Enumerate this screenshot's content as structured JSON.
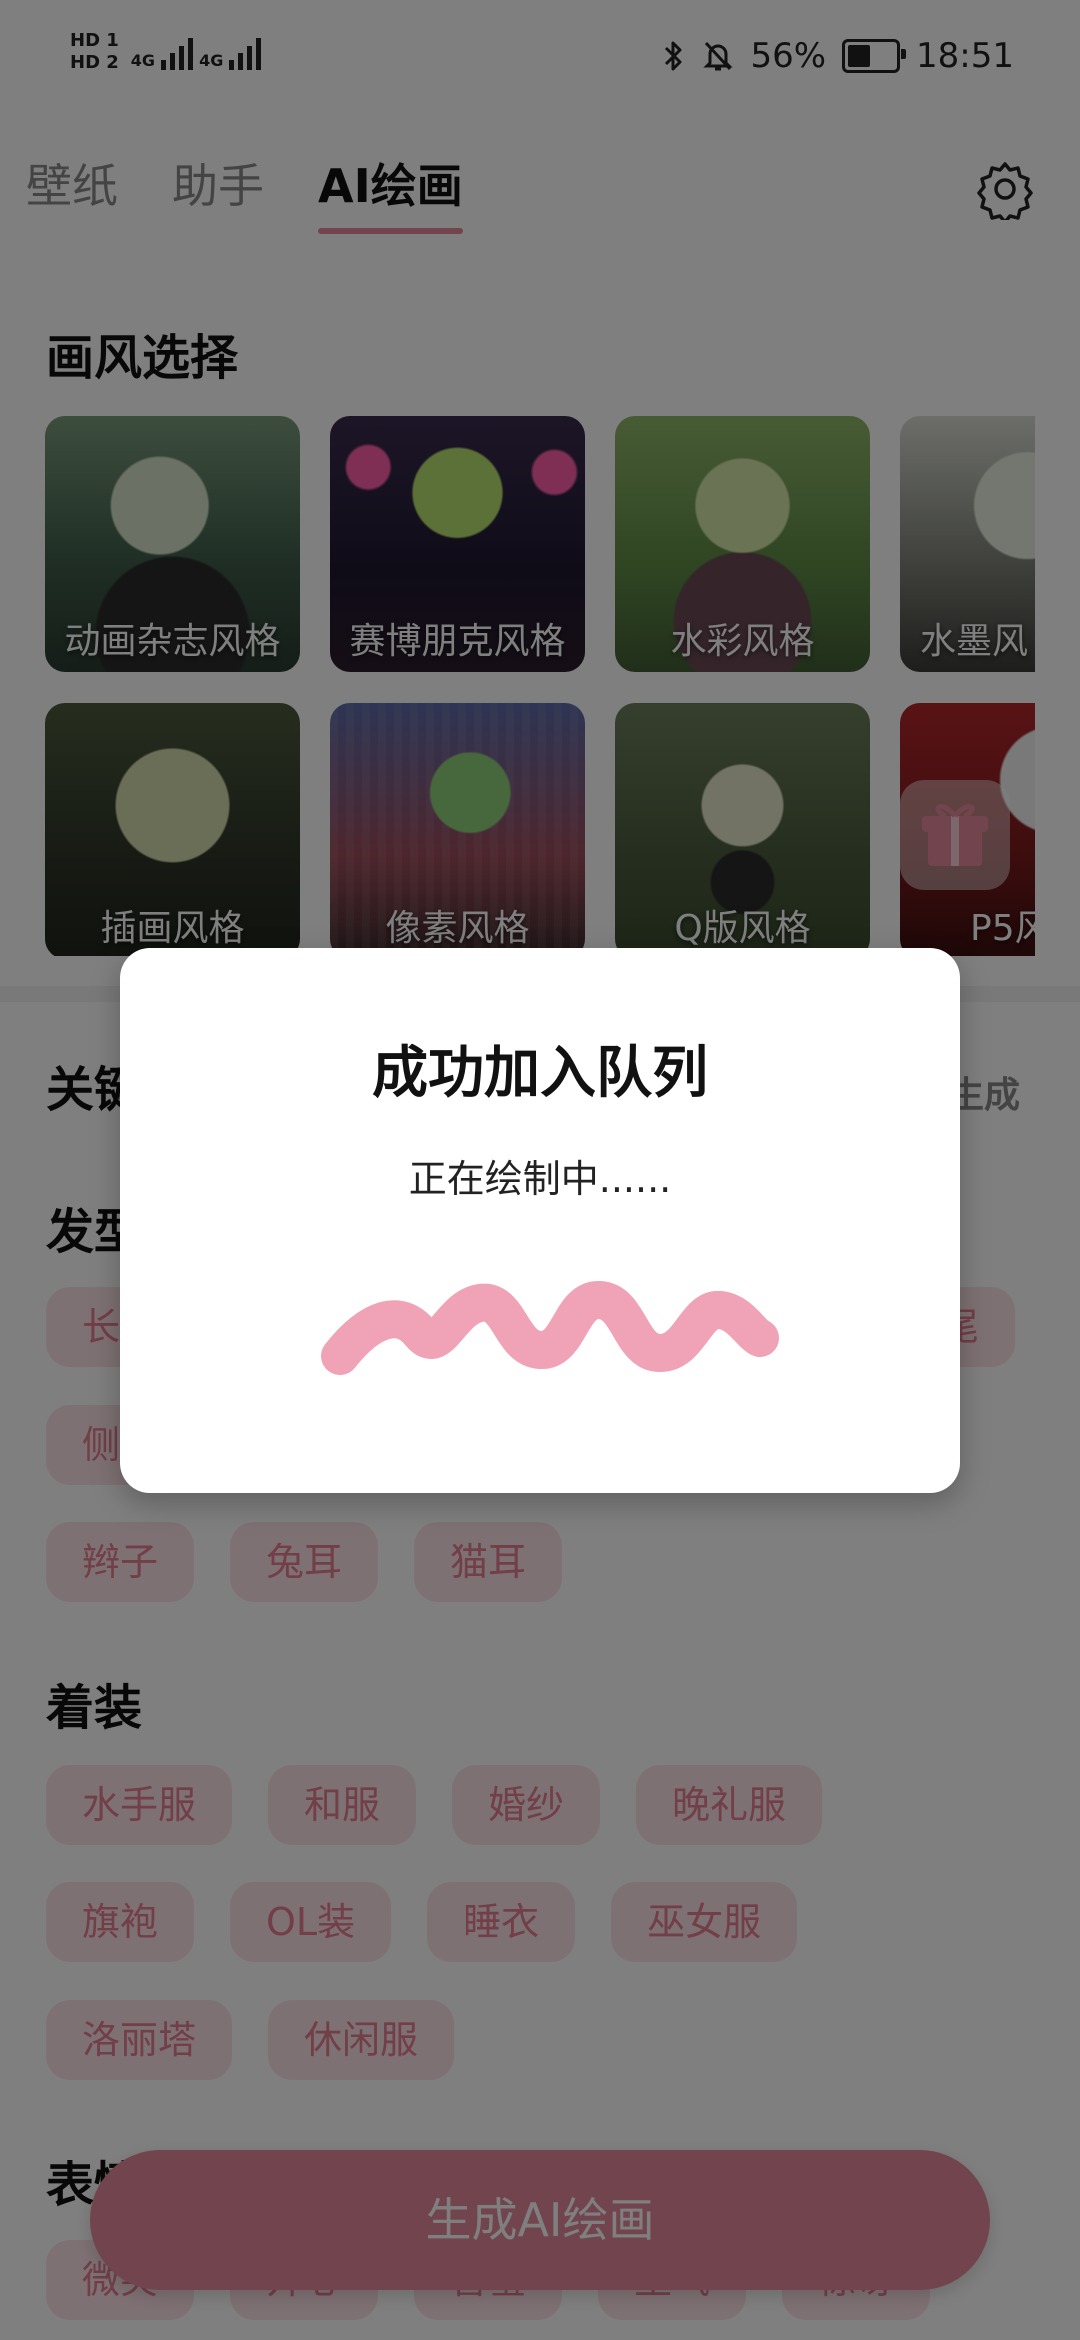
{
  "status": {
    "hd1": "HD 1",
    "hd2": "HD 2",
    "net1": "4G",
    "net2": "4G",
    "battery_percent": "56%",
    "battery_level": 0.56,
    "time": "18:51",
    "icons": [
      "bluetooth-icon",
      "mute-icon",
      "battery-icon"
    ]
  },
  "tabs": [
    {
      "label": "壁纸"
    },
    {
      "label": "助手"
    },
    {
      "label": "AI绘画"
    }
  ],
  "section_styles": "画风选择",
  "styles": [
    {
      "label": "动画杂志风格"
    },
    {
      "label": "赛博朋克风格"
    },
    {
      "label": "水彩风格"
    },
    {
      "label": "水墨风"
    },
    {
      "label": "插画风格"
    },
    {
      "label": "像素风格"
    },
    {
      "label": "Q版风格"
    },
    {
      "label": "P5风"
    }
  ],
  "section_keywords": "关键",
  "generate_link": "生成",
  "section_hair": "发型",
  "hair_chips_row1": [
    "长"
  ],
  "hair_chips_row1_end": "尾",
  "hair_chips_row2": [
    "侧"
  ],
  "hair_chips_row3": [
    "辫子",
    "兔耳",
    "猫耳"
  ],
  "section_outfit": "着装",
  "outfit_row1": [
    "水手服",
    "和服",
    "婚纱",
    "晚礼服"
  ],
  "outfit_row2": [
    "旗袍",
    "OL装",
    "睡衣",
    "巫女服"
  ],
  "outfit_row3": [
    "洛丽塔",
    "休闲服"
  ],
  "section_expression": "表情",
  "expression_row": [
    "微笑",
    "开心",
    "害羞",
    "生气",
    "惊讶"
  ],
  "generate_button": "生成AI绘画",
  "dialog": {
    "title": "成功加入队列",
    "message": "正在绘制中......"
  },
  "colors": {
    "accent": "#e7889a",
    "chip_bg": "#fde2e7",
    "chip_text": "#e47d90",
    "squiggle": "#f0a3b6"
  }
}
